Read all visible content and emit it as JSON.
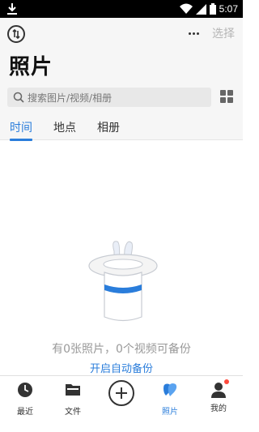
{
  "status_bar": {
    "time": "5:07"
  },
  "header": {
    "title": "照片",
    "select_label": "选择",
    "search_placeholder": "搜索图片/视频/相册"
  },
  "tabs": [
    {
      "label": "时间",
      "active": true
    },
    {
      "label": "地点",
      "active": false
    },
    {
      "label": "相册",
      "active": false
    }
  ],
  "empty_state": {
    "message": "有0张照片，0个视频可备份",
    "action_label": "开启自动备份"
  },
  "bottom_nav": {
    "items": [
      {
        "label": "最近",
        "icon": "clock-icon"
      },
      {
        "label": "文件",
        "icon": "folder-icon"
      },
      {
        "label": "",
        "icon": "plus-icon"
      },
      {
        "label": "照片",
        "icon": "photos-icon",
        "active": true
      },
      {
        "label": "我的",
        "icon": "person-icon",
        "badge": true
      }
    ]
  },
  "colors": {
    "accent": "#2a7ddb",
    "badge": "#ff4a3d"
  }
}
